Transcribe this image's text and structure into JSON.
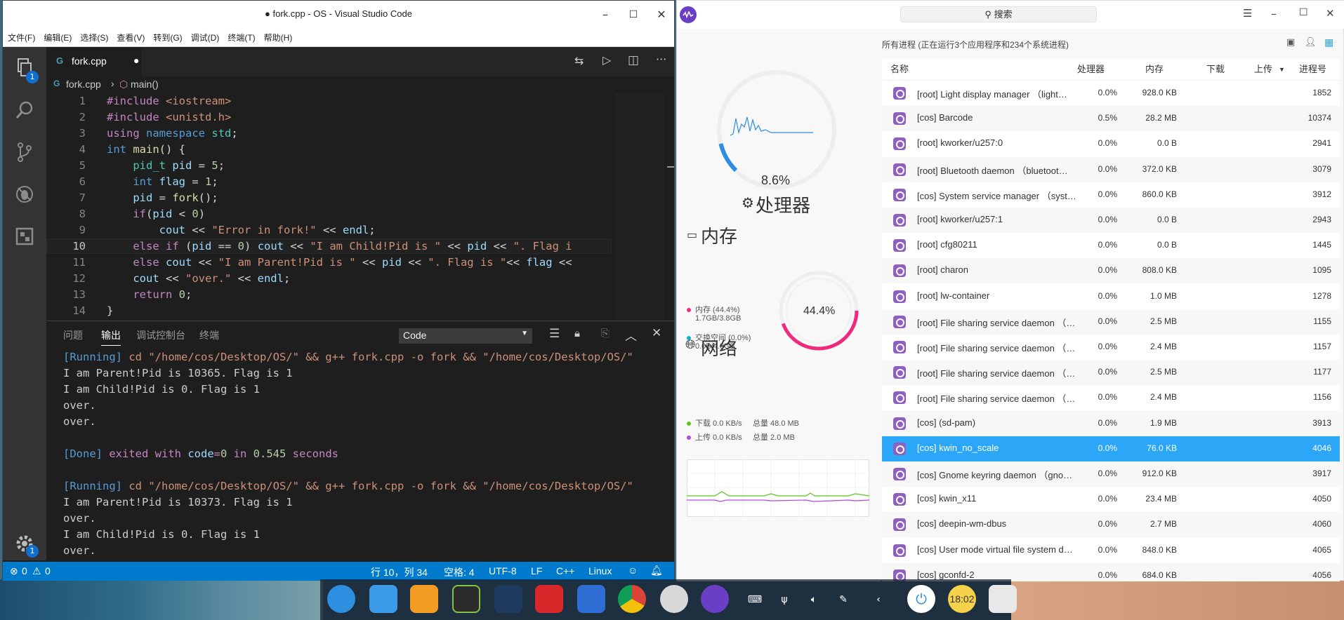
{
  "vscode": {
    "title": "● fork.cpp - OS - Visual Studio Code",
    "menu": [
      "文件(F)",
      "编辑(E)",
      "选择(S)",
      "查看(V)",
      "转到(G)",
      "调试(D)",
      "终端(T)",
      "帮助(H)"
    ],
    "explorer_badge": "1",
    "settings_badge": "1",
    "tab": {
      "name": "fork.cpp",
      "dirty": "●"
    },
    "breadcrumb": {
      "file": "fork.cpp",
      "sep": "›",
      "symbol": "main()"
    },
    "line_numbers": [
      "1",
      "2",
      "3",
      "4",
      "5",
      "6",
      "7",
      "8",
      "9",
      "10",
      "11",
      "12",
      "13",
      "14"
    ],
    "code": [
      "#include <iostream>",
      "#include <unistd.h>",
      "using namespace std;",
      "int main() {",
      "    pid_t pid = 5;",
      "    int flag = 1;",
      "    pid = fork();",
      "    if(pid < 0)",
      "        cout << \"Error in fork!\" << endl;",
      "    else if (pid == 0) cout << \"I am Child!Pid is \" << pid << \". Flag i",
      "    else cout << \"I am Parent!Pid is \" << pid << \". Flag is \"<< flag <<",
      "    cout << \"over.\" << endl;",
      "    return 0;",
      "}"
    ],
    "panel_tabs": [
      "问题",
      "输出",
      "调试控制台",
      "终端"
    ],
    "output_selector": "Code",
    "output": [
      "[Running] cd \"/home/cos/Desktop/OS/\" && g++ fork.cpp -o fork && \"/home/cos/Desktop/OS/\"",
      "I am Parent!Pid is 10365. Flag is 1",
      "I am Child!Pid is 0. Flag is 1",
      "over.",
      "over.",
      "",
      "[Done] exited with code=0 in 0.545 seconds",
      "",
      "[Running] cd \"/home/cos/Desktop/OS/\" && g++ fork.cpp -o fork && \"/home/cos/Desktop/OS/\"",
      "I am Parent!Pid is 10373. Flag is 1",
      "over.",
      "I am Child!Pid is 0. Flag is 1",
      "over."
    ],
    "status": {
      "errors": "0",
      "warnings": "0",
      "position": "行 10，列 34",
      "spaces": "空格: 4",
      "encoding": "UTF-8",
      "eol": "LF",
      "language": "C++",
      "os": "Linux"
    }
  },
  "monitor": {
    "search_placeholder": "搜索",
    "summary": "所有进程 (正在运行3个应用程序和234个系统进程)",
    "cpu": {
      "percent_label": "8.6%",
      "percent": 8.6,
      "title": "处理器"
    },
    "memory": {
      "title": "内存",
      "mem_label": "内存 (44.4%)",
      "mem_detail": "1.7GB/3.8GB",
      "swap_label": "交换空间 (0.0%)",
      "swap_detail": "0.0B/4.0GB",
      "percent_label": "44.4%",
      "percent": 44.4,
      "mem_color": "#f0297c",
      "swap_color": "#14b4c8"
    },
    "network": {
      "title": "网络",
      "down": "下载 0.0 KB/s",
      "down_total": "总量 48.0 MB",
      "up": "上传 0.0 KB/s",
      "up_total": "总量 2.0 MB",
      "down_color": "#58c81c",
      "up_color": "#b04de0"
    },
    "columns": [
      "名称",
      "处理器",
      "内存",
      "下载",
      "上传",
      "进程号"
    ],
    "processes": [
      {
        "name": "[root] Light display manager （light…",
        "cpu": "0.0%",
        "mem": "928.0 KB",
        "pid": "1852"
      },
      {
        "name": "[cos] Barcode",
        "cpu": "0.5%",
        "mem": "28.2 MB",
        "pid": "10374"
      },
      {
        "name": "[root] kworker/u257:0",
        "cpu": "0.0%",
        "mem": "0.0 B",
        "pid": "2941"
      },
      {
        "name": "[root] Bluetooth daemon （bluetoot…",
        "cpu": "0.0%",
        "mem": "372.0 KB",
        "pid": "3079"
      },
      {
        "name": "[cos] System service manager （syst…",
        "cpu": "0.0%",
        "mem": "860.0 KB",
        "pid": "3912"
      },
      {
        "name": "[root] kworker/u257:1",
        "cpu": "0.0%",
        "mem": "0.0 B",
        "pid": "2943"
      },
      {
        "name": "[root] cfg80211",
        "cpu": "0.0%",
        "mem": "0.0 B",
        "pid": "1445"
      },
      {
        "name": "[root] charon",
        "cpu": "0.0%",
        "mem": "808.0 KB",
        "pid": "1095"
      },
      {
        "name": "[root] lw-container",
        "cpu": "0.0%",
        "mem": "1.0 MB",
        "pid": "1278"
      },
      {
        "name": "[root] File sharing service daemon （…",
        "cpu": "0.0%",
        "mem": "2.5 MB",
        "pid": "1155"
      },
      {
        "name": "[root] File sharing service daemon （…",
        "cpu": "0.0%",
        "mem": "2.4 MB",
        "pid": "1157"
      },
      {
        "name": "[root] File sharing service daemon （…",
        "cpu": "0.0%",
        "mem": "2.5 MB",
        "pid": "1177"
      },
      {
        "name": "[root] File sharing service daemon （…",
        "cpu": "0.0%",
        "mem": "2.4 MB",
        "pid": "1156"
      },
      {
        "name": "[cos] (sd-pam)",
        "cpu": "0.0%",
        "mem": "1.9 MB",
        "pid": "3913"
      },
      {
        "name": "[cos] kwin_no_scale",
        "cpu": "0.0%",
        "mem": "76.0 KB",
        "pid": "4046"
      },
      {
        "name": "[cos] Gnome keyring daemon （gno…",
        "cpu": "0.0%",
        "mem": "912.0 KB",
        "pid": "3917"
      },
      {
        "name": "[cos] kwin_x11",
        "cpu": "0.0%",
        "mem": "23.4 MB",
        "pid": "4050"
      },
      {
        "name": "[cos] deepin-wm-dbus",
        "cpu": "0.0%",
        "mem": "2.7 MB",
        "pid": "4060"
      },
      {
        "name": "[cos] User mode virtual file system d…",
        "cpu": "0.0%",
        "mem": "848.0 KB",
        "pid": "4065"
      },
      {
        "name": "[cos] gconfd-2",
        "cpu": "0.0%",
        "mem": "684.0 KB",
        "pid": "4056"
      }
    ],
    "selected_index": 14,
    "accent": "#2ca7f8"
  },
  "taskbar": {
    "apps": [
      "deepin-launcher-icon",
      "file-manager-icon",
      "app-store-icon",
      "music-icon",
      "vscode-icon",
      "terminal-icon",
      "video-icon",
      "chrome-icon",
      "settings-icon",
      "system-monitor-icon"
    ],
    "clock": "18:02",
    "tray": [
      "keyboard-icon",
      "usb-icon",
      "volume-icon",
      "pen-icon",
      "chevron-left-icon"
    ]
  }
}
